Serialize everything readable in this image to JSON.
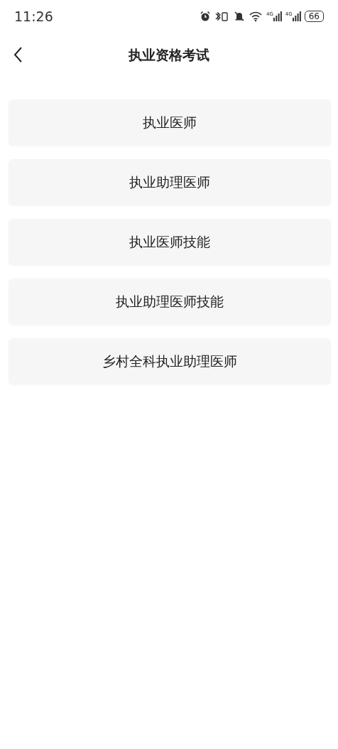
{
  "status_bar": {
    "time": "11:26",
    "signals": [
      {
        "network": "4G"
      },
      {
        "network": "4G"
      }
    ],
    "battery": "66"
  },
  "header": {
    "title": "执业资格考试"
  },
  "items": [
    {
      "label": "执业医师"
    },
    {
      "label": "执业助理医师"
    },
    {
      "label": "执业医师技能"
    },
    {
      "label": "执业助理医师技能"
    },
    {
      "label": "乡村全科执业助理医师"
    }
  ]
}
